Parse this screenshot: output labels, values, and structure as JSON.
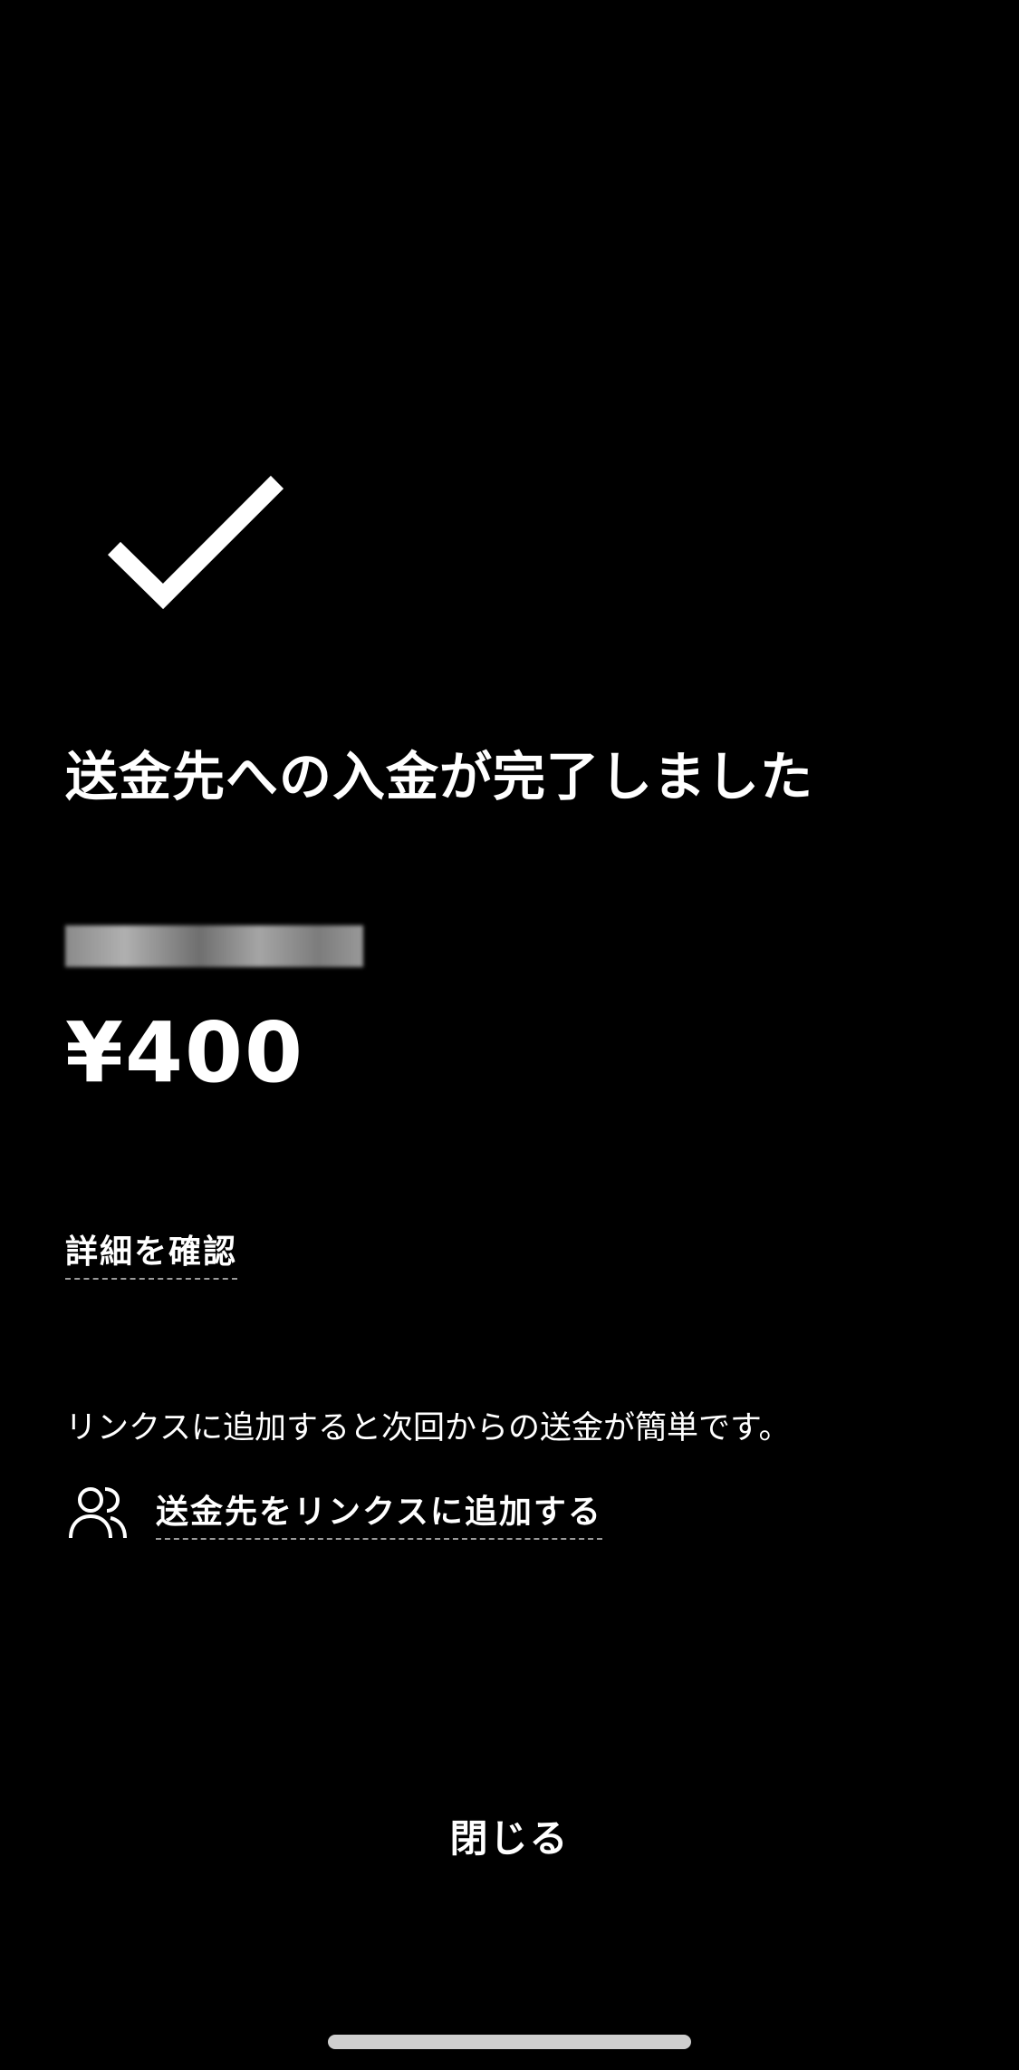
{
  "completion": {
    "icon": "checkmark-icon",
    "title": "送金先への入金が完了しました",
    "recipient_name": "",
    "amount": "¥400"
  },
  "actions": {
    "details_link": "詳細を確認",
    "hint_text": "リンクスに追加すると次回からの送金が簡単です。",
    "add_link_icon": "people-icon",
    "add_link": "送金先をリンクスに追加する",
    "close_button": "閉じる"
  },
  "colors": {
    "background": "#000000",
    "text": "#ffffff",
    "link_underline": "#9a9a9a",
    "home_indicator": "#cfcfcf"
  }
}
